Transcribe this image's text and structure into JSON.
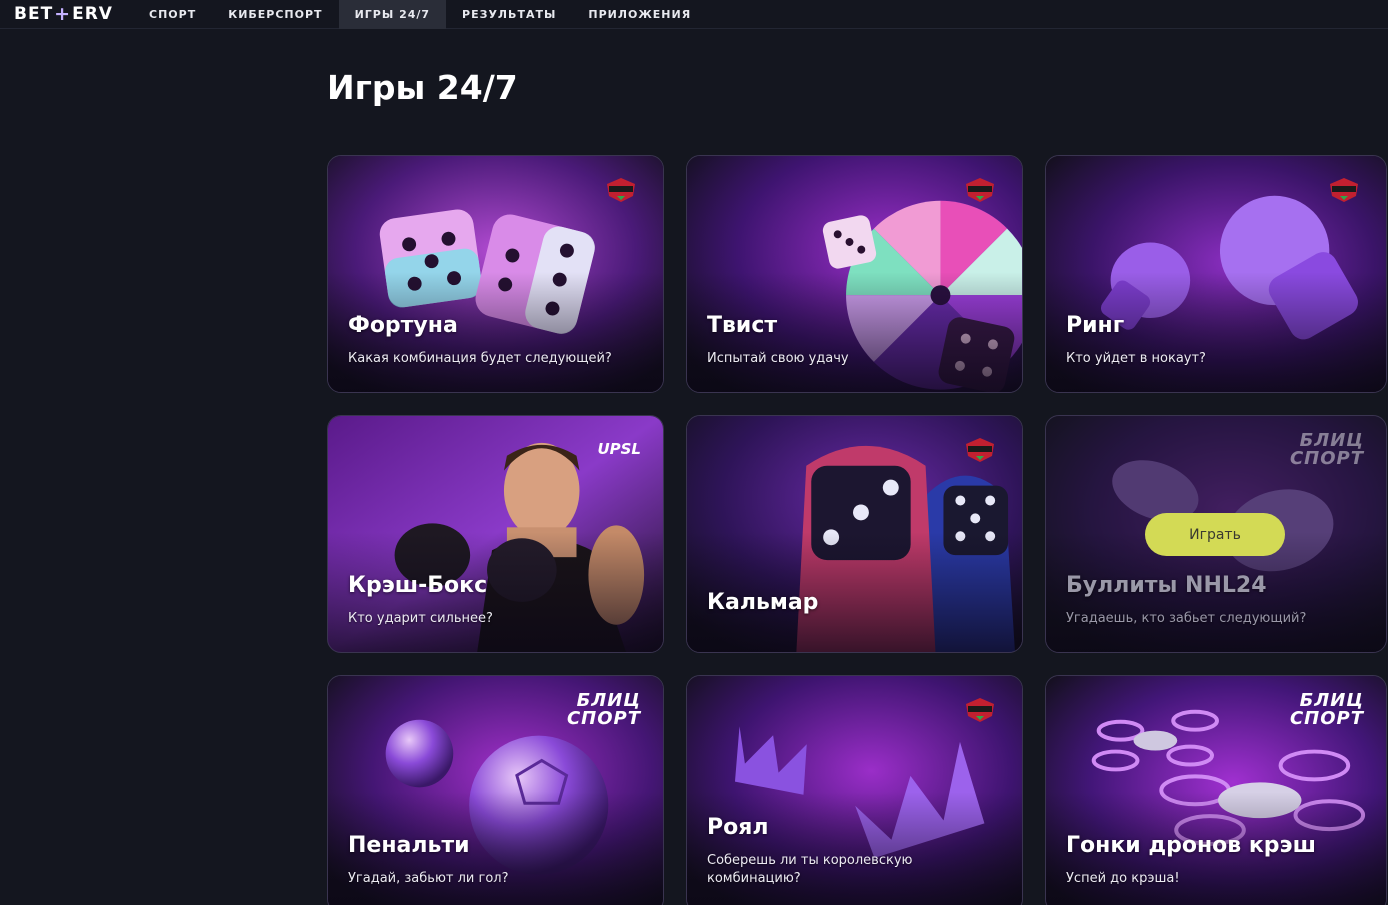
{
  "brand": {
    "logo_left": "BET",
    "logo_plus": "+",
    "logo_right": "ERV"
  },
  "nav": {
    "items": [
      {
        "label": "СПОРТ"
      },
      {
        "label": "КИБЕРСПОРТ"
      },
      {
        "label": "ИГРЫ 24/7"
      },
      {
        "label": "РЕЗУЛЬТАТЫ"
      },
      {
        "label": "ПРИЛОЖЕНИЯ"
      }
    ]
  },
  "page": {
    "title": "Игры 24/7"
  },
  "games": [
    {
      "title": "Фортуна",
      "subtitle": "Какая комбинация будет следующей?",
      "brand": "NARDOBALL"
    },
    {
      "title": "Твист",
      "subtitle": "Испытай свою удачу",
      "brand": "NARDOBALL"
    },
    {
      "title": "Ринг",
      "subtitle": "Кто уйдет в нокаут?",
      "brand": "NARDOBALL"
    },
    {
      "title": "Крэш-Бокс",
      "subtitle": "Кто ударит сильнее?",
      "brand": "UPSL"
    },
    {
      "title": "Кальмар",
      "subtitle": "",
      "brand": "NARDOBALL"
    },
    {
      "title": "Буллиты NHL24",
      "subtitle": "Угадаешь, кто забьет следующий?",
      "brand_line1": "БЛИЦ",
      "brand_line2": "СПОРТ",
      "play_label": "Играть"
    },
    {
      "title": "Пенальти",
      "subtitle": "Угадай, забьют ли гол?",
      "brand_line1": "БЛИЦ",
      "brand_line2": "СПОРТ"
    },
    {
      "title": "Роял",
      "subtitle": "Соберешь ли ты королевскую комбинацию?",
      "brand": "NARDOBALL"
    },
    {
      "title": "Гонки дронов крэш",
      "subtitle": "Успей до крэша!",
      "brand_line1": "БЛИЦ",
      "brand_line2": "СПОРТ"
    }
  ],
  "colors": {
    "background": "#14161f",
    "accent": "#c4b1ff",
    "play_button": "#d3da55"
  }
}
